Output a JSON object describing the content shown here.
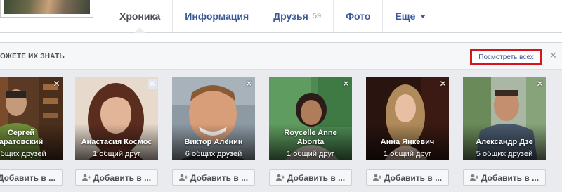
{
  "tabs": [
    {
      "label": "Хроника",
      "active": true
    },
    {
      "label": "Информация"
    },
    {
      "label": "Друзья",
      "count": "59"
    },
    {
      "label": "Фото"
    },
    {
      "label": "Еще"
    }
  ],
  "pymk": {
    "title": "ОЖЕТЕ ИХ ЗНАТЬ",
    "see_all": "Посмотреть всех",
    "close": "✕",
    "people": [
      {
        "name_line1": "Сергей",
        "name_line2": "аратовский",
        "mutual": "общих друзей",
        "add": "Добавить в ..."
      },
      {
        "name_line1": "Анастасия Космос",
        "name_line2": "",
        "mutual": "1 общий друг",
        "add": "Добавить в ..."
      },
      {
        "name_line1": "Виктор Алёнин",
        "name_line2": "",
        "mutual": "6 общих друзей",
        "add": "Добавить в ..."
      },
      {
        "name_line1": "Roycelle Anne",
        "name_line2": "Aborita",
        "mutual": "1 общий друг",
        "add": "Добавить в ..."
      },
      {
        "name_line1": "Анна Янкевич",
        "name_line2": "",
        "mutual": "1 общий друг",
        "add": "Добавить в ..."
      },
      {
        "name_line1": "Александр Дзе",
        "name_line2": "",
        "mutual": "5 общих друзей",
        "add": "Добавить в ..."
      }
    ]
  },
  "colors": {
    "link": "#3b5998",
    "highlight_border": "#d7141c",
    "panel_bg": "#e9ebee"
  }
}
